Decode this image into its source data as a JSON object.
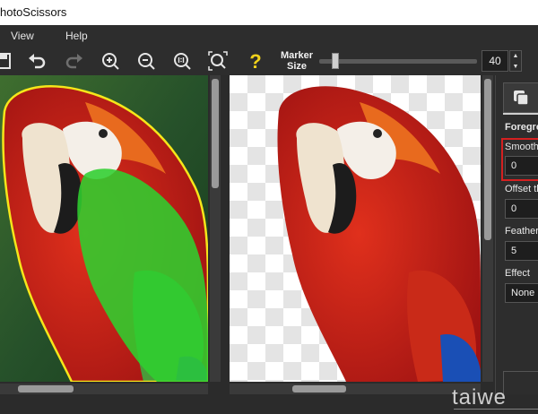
{
  "app": {
    "title": "hotoScissors"
  },
  "menu": {
    "items": [
      "View",
      "Help"
    ]
  },
  "toolbar": {
    "marker_label_line1": "Marker",
    "marker_label_line2": "Size",
    "marker_value": "40",
    "marker_level": 0.1,
    "icons": [
      "save-icon",
      "undo-icon",
      "redo-icon",
      "zoom-in-icon",
      "zoom-out-icon",
      "zoom-actual-icon",
      "zoom-fit-icon",
      "help-icon"
    ]
  },
  "panel": {
    "tab_label": "Foregro",
    "smooth_label": "Smooth t",
    "smooth_value": "0",
    "offset_label": "Offset the",
    "offset_value": "0",
    "feathering_label": "Featherin",
    "feathering_value": "5",
    "effect_label": "Effect",
    "effect_value": "None"
  },
  "watermark": "taiwe",
  "colors": {
    "outline": "#f5e61a",
    "marker": "#2fcf2f",
    "accent_red": "#d42020",
    "help_icon": "#f2d21b"
  }
}
